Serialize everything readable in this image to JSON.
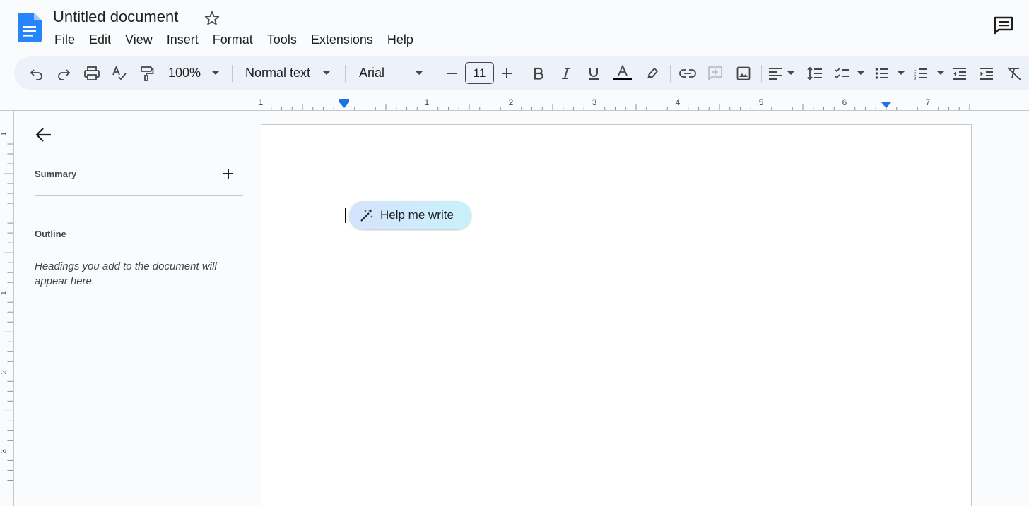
{
  "app": {
    "title": "Untitled document",
    "brand_color": "#1a73e8"
  },
  "menu": [
    "File",
    "Edit",
    "View",
    "Insert",
    "Format",
    "Tools",
    "Extensions",
    "Help"
  ],
  "toolbar": {
    "zoom": "100%",
    "style": "Normal text",
    "font": "Arial",
    "font_size": "11",
    "icons": [
      "undo-icon",
      "redo-icon",
      "print-icon",
      "spellcheck-icon",
      "paint-format-icon",
      "bold-icon",
      "italic-icon",
      "underline-icon",
      "text-color-icon",
      "highlight-icon",
      "link-icon",
      "add-comment-icon",
      "image-icon",
      "align-left-icon",
      "line-spacing-icon",
      "checklist-icon",
      "bulleted-list-icon",
      "numbered-list-icon",
      "decrease-indent-icon",
      "increase-indent-icon",
      "clear-formatting-icon"
    ]
  },
  "ruler": {
    "horizontal_labels": [
      "1",
      "1",
      "2",
      "3",
      "4",
      "5",
      "6",
      "7"
    ],
    "vertical_labels": [
      "1",
      "1",
      "2",
      "3"
    ]
  },
  "sidebar": {
    "summary_label": "Summary",
    "outline_label": "Outline",
    "outline_hint": "Headings you add to the document will appear here."
  },
  "editor": {
    "help_me_write": "Help me write"
  }
}
